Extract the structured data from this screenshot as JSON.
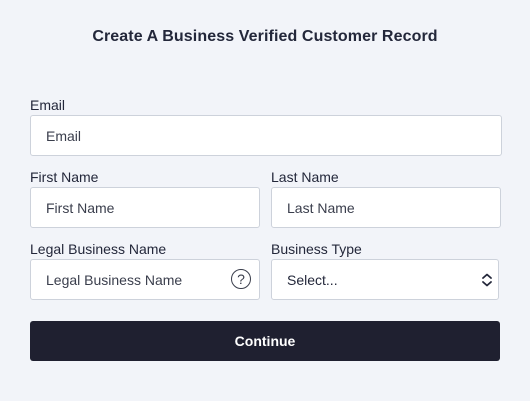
{
  "form": {
    "title": "Create A Business Verified Customer Record",
    "email": {
      "label": "Email",
      "placeholder": "Email",
      "value": ""
    },
    "first_name": {
      "label": "First Name",
      "placeholder": "First Name",
      "value": ""
    },
    "last_name": {
      "label": "Last Name",
      "placeholder": "Last Name",
      "value": ""
    },
    "legal_business_name": {
      "label": "Legal Business Name",
      "placeholder": "Legal Business Name",
      "value": "",
      "help_icon": "?"
    },
    "business_type": {
      "label": "Business Type",
      "selected": "Select..."
    },
    "continue_label": "Continue"
  },
  "icons": {
    "help": "question-circle-icon",
    "dropdown": "chevron-updown-icon"
  },
  "colors": {
    "background": "#f2f4f9",
    "button": "#1f2030",
    "button_text": "#ffffff",
    "border": "#cdd2db"
  }
}
